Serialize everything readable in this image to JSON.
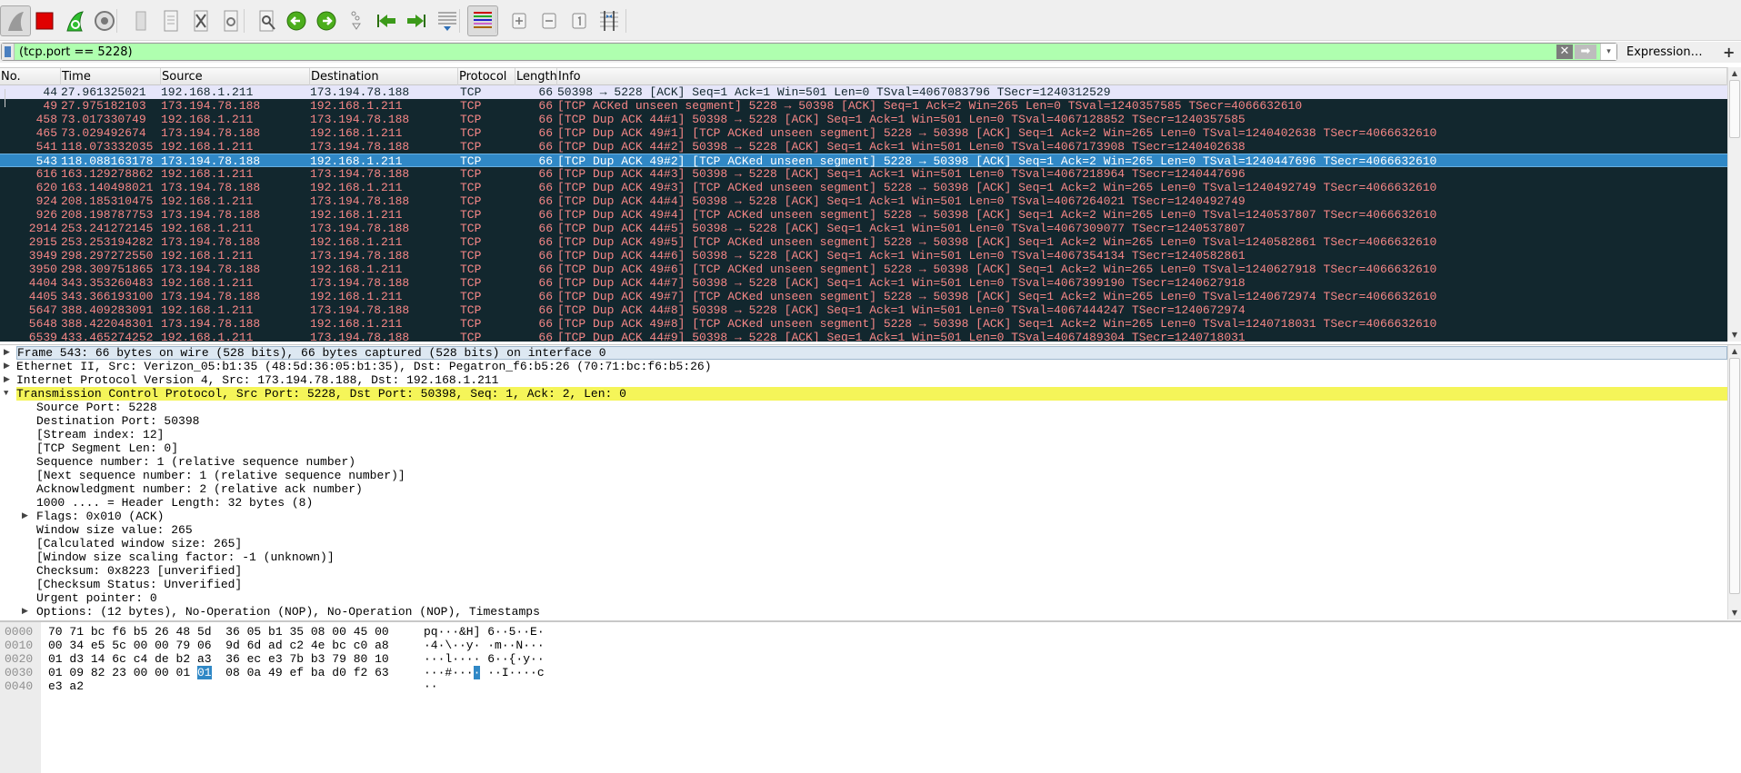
{
  "toolbar": {
    "buttons": [
      {
        "icon": "shark-fin-start-icon",
        "pressed": true
      },
      {
        "icon": "stop-capture-icon"
      },
      {
        "icon": "restart-capture-icon"
      },
      {
        "icon": "capture-options-icon"
      },
      {
        "icon": "open-file-icon"
      },
      {
        "icon": "save-file-icon"
      },
      {
        "icon": "close-file-icon"
      },
      {
        "icon": "reload-file-icon"
      },
      {
        "icon": "find-packet-icon"
      },
      {
        "icon": "go-back-icon"
      },
      {
        "icon": "go-forward-icon"
      },
      {
        "icon": "go-to-packet-icon"
      },
      {
        "icon": "first-packet-icon"
      },
      {
        "icon": "last-packet-icon"
      },
      {
        "icon": "autoscroll-icon"
      },
      {
        "icon": "colorize-icon",
        "pressed": true
      },
      {
        "icon": "zoom-in-icon"
      },
      {
        "icon": "zoom-out-icon"
      },
      {
        "icon": "normal-size-icon"
      },
      {
        "icon": "resize-columns-icon"
      }
    ]
  },
  "filter": {
    "value": "(tcp.port == 5228)",
    "clear_glyph": "✕",
    "apply_glyph": "➡",
    "dropdown_glyph": "▾",
    "expression_label": "Expression…",
    "add_label": "+"
  },
  "packet_list": {
    "columns": [
      "No.",
      "Time",
      "Source",
      "Destination",
      "Protocol",
      "Length",
      "Info"
    ],
    "selected_index": 5,
    "colors": {
      "bad_bg": "#12272e",
      "bad_fg": "#f78787",
      "normal_bg": "#e6e6fa",
      "selected_bg": "#3088c6"
    },
    "rows": [
      {
        "no": "44",
        "time": "27.961325021",
        "src": "192.168.1.211",
        "dst": "173.194.78.188",
        "proto": "TCP",
        "len": "66",
        "info": "50398 → 5228 [ACK] Seq=1 Ack=1 Win=501 Len=0 TSval=4067083796 TSecr=1240312529",
        "style": "norm"
      },
      {
        "no": "49",
        "time": "27.975182103",
        "src": "173.194.78.188",
        "dst": "192.168.1.211",
        "proto": "TCP",
        "len": "66",
        "info": "[TCP ACKed unseen segment] 5228 → 50398 [ACK] Seq=1 Ack=2 Win=265 Len=0 TSval=1240357585 TSecr=4066632610",
        "style": "bad"
      },
      {
        "no": "458",
        "time": "73.017330749",
        "src": "192.168.1.211",
        "dst": "173.194.78.188",
        "proto": "TCP",
        "len": "66",
        "info": "[TCP Dup ACK 44#1] 50398 → 5228 [ACK] Seq=1 Ack=1 Win=501 Len=0 TSval=4067128852 TSecr=1240357585",
        "style": "bad"
      },
      {
        "no": "465",
        "time": "73.029492674",
        "src": "173.194.78.188",
        "dst": "192.168.1.211",
        "proto": "TCP",
        "len": "66",
        "info": "[TCP Dup ACK 49#1] [TCP ACKed unseen segment] 5228 → 50398 [ACK] Seq=1 Ack=2 Win=265 Len=0 TSval=1240402638 TSecr=4066632610",
        "style": "bad"
      },
      {
        "no": "541",
        "time": "118.073332035",
        "src": "192.168.1.211",
        "dst": "173.194.78.188",
        "proto": "TCP",
        "len": "66",
        "info": "[TCP Dup ACK 44#2] 50398 → 5228 [ACK] Seq=1 Ack=1 Win=501 Len=0 TSval=4067173908 TSecr=1240402638",
        "style": "bad"
      },
      {
        "no": "543",
        "time": "118.088163178",
        "src": "173.194.78.188",
        "dst": "192.168.1.211",
        "proto": "TCP",
        "len": "66",
        "info": "[TCP Dup ACK 49#2] [TCP ACKed unseen segment] 5228 → 50398 [ACK] Seq=1 Ack=2 Win=265 Len=0 TSval=1240447696 TSecr=4066632610",
        "style": "sel"
      },
      {
        "no": "616",
        "time": "163.129278862",
        "src": "192.168.1.211",
        "dst": "173.194.78.188",
        "proto": "TCP",
        "len": "66",
        "info": "[TCP Dup ACK 44#3] 50398 → 5228 [ACK] Seq=1 Ack=1 Win=501 Len=0 TSval=4067218964 TSecr=1240447696",
        "style": "bad"
      },
      {
        "no": "620",
        "time": "163.140498021",
        "src": "173.194.78.188",
        "dst": "192.168.1.211",
        "proto": "TCP",
        "len": "66",
        "info": "[TCP Dup ACK 49#3] [TCP ACKed unseen segment] 5228 → 50398 [ACK] Seq=1 Ack=2 Win=265 Len=0 TSval=1240492749 TSecr=4066632610",
        "style": "bad"
      },
      {
        "no": "924",
        "time": "208.185310475",
        "src": "192.168.1.211",
        "dst": "173.194.78.188",
        "proto": "TCP",
        "len": "66",
        "info": "[TCP Dup ACK 44#4] 50398 → 5228 [ACK] Seq=1 Ack=1 Win=501 Len=0 TSval=4067264021 TSecr=1240492749",
        "style": "bad"
      },
      {
        "no": "926",
        "time": "208.198787753",
        "src": "173.194.78.188",
        "dst": "192.168.1.211",
        "proto": "TCP",
        "len": "66",
        "info": "[TCP Dup ACK 49#4] [TCP ACKed unseen segment] 5228 → 50398 [ACK] Seq=1 Ack=2 Win=265 Len=0 TSval=1240537807 TSecr=4066632610",
        "style": "bad"
      },
      {
        "no": "2914",
        "time": "253.241272145",
        "src": "192.168.1.211",
        "dst": "173.194.78.188",
        "proto": "TCP",
        "len": "66",
        "info": "[TCP Dup ACK 44#5] 50398 → 5228 [ACK] Seq=1 Ack=1 Win=501 Len=0 TSval=4067309077 TSecr=1240537807",
        "style": "bad"
      },
      {
        "no": "2915",
        "time": "253.253194282",
        "src": "173.194.78.188",
        "dst": "192.168.1.211",
        "proto": "TCP",
        "len": "66",
        "info": "[TCP Dup ACK 49#5] [TCP ACKed unseen segment] 5228 → 50398 [ACK] Seq=1 Ack=2 Win=265 Len=0 TSval=1240582861 TSecr=4066632610",
        "style": "bad"
      },
      {
        "no": "3949",
        "time": "298.297272550",
        "src": "192.168.1.211",
        "dst": "173.194.78.188",
        "proto": "TCP",
        "len": "66",
        "info": "[TCP Dup ACK 44#6] 50398 → 5228 [ACK] Seq=1 Ack=1 Win=501 Len=0 TSval=4067354134 TSecr=1240582861",
        "style": "bad"
      },
      {
        "no": "3950",
        "time": "298.309751865",
        "src": "173.194.78.188",
        "dst": "192.168.1.211",
        "proto": "TCP",
        "len": "66",
        "info": "[TCP Dup ACK 49#6] [TCP ACKed unseen segment] 5228 → 50398 [ACK] Seq=1 Ack=2 Win=265 Len=0 TSval=1240627918 TSecr=4066632610",
        "style": "bad"
      },
      {
        "no": "4404",
        "time": "343.353260483",
        "src": "192.168.1.211",
        "dst": "173.194.78.188",
        "proto": "TCP",
        "len": "66",
        "info": "[TCP Dup ACK 44#7] 50398 → 5228 [ACK] Seq=1 Ack=1 Win=501 Len=0 TSval=4067399190 TSecr=1240627918",
        "style": "bad"
      },
      {
        "no": "4405",
        "time": "343.366193100",
        "src": "173.194.78.188",
        "dst": "192.168.1.211",
        "proto": "TCP",
        "len": "66",
        "info": "[TCP Dup ACK 49#7] [TCP ACKed unseen segment] 5228 → 50398 [ACK] Seq=1 Ack=2 Win=265 Len=0 TSval=1240672974 TSecr=4066632610",
        "style": "bad"
      },
      {
        "no": "5647",
        "time": "388.409283091",
        "src": "192.168.1.211",
        "dst": "173.194.78.188",
        "proto": "TCP",
        "len": "66",
        "info": "[TCP Dup ACK 44#8] 50398 → 5228 [ACK] Seq=1 Ack=1 Win=501 Len=0 TSval=4067444247 TSecr=1240672974",
        "style": "bad"
      },
      {
        "no": "5648",
        "time": "388.422048301",
        "src": "173.194.78.188",
        "dst": "192.168.1.211",
        "proto": "TCP",
        "len": "66",
        "info": "[TCP Dup ACK 49#8] [TCP ACKed unseen segment] 5228 → 50398 [ACK] Seq=1 Ack=2 Win=265 Len=0 TSval=1240718031 TSecr=4066632610",
        "style": "bad"
      },
      {
        "no": "6539",
        "time": "433.465274252",
        "src": "192.168.1.211",
        "dst": "173.194.78.188",
        "proto": "TCP",
        "len": "66",
        "info": "[TCP Dup ACK 44#9] 50398 → 5228 [ACK] Seq=1 Ack=1 Win=501 Len=0 TSval=4067489304 TSecr=1240718031",
        "style": "bad"
      }
    ]
  },
  "details": {
    "rows": [
      {
        "text": "Frame 543: 66 bytes on wire (528 bits), 66 bytes captured (528 bits) on interface 0",
        "depth": 0,
        "arrow": "▶",
        "style": "framehl"
      },
      {
        "text": "Ethernet II, Src: Verizon_05:b1:35 (48:5d:36:05:b1:35), Dst: Pegatron_f6:b5:26 (70:71:bc:f6:b5:26)",
        "depth": 0,
        "arrow": "▶"
      },
      {
        "text": "Internet Protocol Version 4, Src: 173.194.78.188, Dst: 192.168.1.211",
        "depth": 0,
        "arrow": "▶"
      },
      {
        "text": "Transmission Control Protocol, Src Port: 5228, Dst Port: 50398, Seq: 1, Ack: 2, Len: 0",
        "depth": 0,
        "arrow": "▼",
        "style": "yel"
      },
      {
        "text": "Source Port: 5228",
        "depth": 1
      },
      {
        "text": "Destination Port: 50398",
        "depth": 1
      },
      {
        "text": "[Stream index: 12]",
        "depth": 1
      },
      {
        "text": "[TCP Segment Len: 0]",
        "depth": 1
      },
      {
        "text": "Sequence number: 1    (relative sequence number)",
        "depth": 1
      },
      {
        "text": "[Next sequence number: 1    (relative sequence number)]",
        "depth": 1
      },
      {
        "text": "Acknowledgment number: 2    (relative ack number)",
        "depth": 1
      },
      {
        "text": "1000 .... = Header Length: 32 bytes (8)",
        "depth": 1
      },
      {
        "text": "Flags: 0x010 (ACK)",
        "depth": 1,
        "arrow": "▶"
      },
      {
        "text": "Window size value: 265",
        "depth": 1
      },
      {
        "text": "[Calculated window size: 265]",
        "depth": 1
      },
      {
        "text": "[Window size scaling factor: -1 (unknown)]",
        "depth": 1
      },
      {
        "text": "Checksum: 0x8223 [unverified]",
        "depth": 1
      },
      {
        "text": "[Checksum Status: Unverified]",
        "depth": 1
      },
      {
        "text": "Urgent pointer: 0",
        "depth": 1
      },
      {
        "text": "Options: (12 bytes), No-Operation (NOP), No-Operation (NOP), Timestamps",
        "depth": 1,
        "arrow": "▶"
      }
    ]
  },
  "hex": {
    "highlight": {
      "row": 3,
      "byte": 7
    },
    "rows": [
      {
        "offset": "0000",
        "bytes": [
          "70",
          "71",
          "bc",
          "f6",
          "b5",
          "26",
          "48",
          "5d",
          "36",
          "05",
          "b1",
          "35",
          "08",
          "00",
          "45",
          "00"
        ],
        "ascii": "pq···&H] 6··5··E·"
      },
      {
        "offset": "0010",
        "bytes": [
          "00",
          "34",
          "e5",
          "5c",
          "00",
          "00",
          "79",
          "06",
          "9d",
          "6d",
          "ad",
          "c2",
          "4e",
          "bc",
          "c0",
          "a8"
        ],
        "ascii": "·4·\\··y· ·m··N···"
      },
      {
        "offset": "0020",
        "bytes": [
          "01",
          "d3",
          "14",
          "6c",
          "c4",
          "de",
          "b2",
          "a3",
          "36",
          "ec",
          "e3",
          "7b",
          "b3",
          "79",
          "80",
          "10"
        ],
        "ascii": "···l···· 6··{·y··"
      },
      {
        "offset": "0030",
        "bytes": [
          "01",
          "09",
          "82",
          "23",
          "00",
          "00",
          "01",
          "01",
          "08",
          "0a",
          "49",
          "ef",
          "ba",
          "d0",
          "f2",
          "63"
        ],
        "ascii": "···#···· ··I····c"
      },
      {
        "offset": "0040",
        "bytes": [
          "e3",
          "a2"
        ],
        "ascii": "··"
      }
    ]
  }
}
